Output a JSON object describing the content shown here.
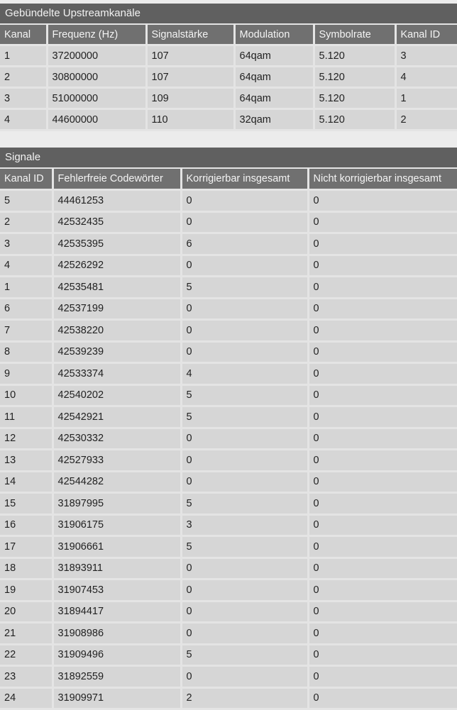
{
  "upstream": {
    "title": "Gebündelte Upstreamkanäle",
    "headers": [
      "Kanal",
      "Frequenz (Hz)",
      "Signalstärke",
      "Modulation",
      "Symbolrate",
      "Kanal ID"
    ],
    "rows": [
      [
        "1",
        "37200000",
        "107",
        "64qam",
        "5.120",
        "3"
      ],
      [
        "2",
        "30800000",
        "107",
        "64qam",
        "5.120",
        "4"
      ],
      [
        "3",
        "51000000",
        "109",
        "64qam",
        "5.120",
        "1"
      ],
      [
        "4",
        "44600000",
        "110",
        "32qam",
        "5.120",
        "2"
      ]
    ]
  },
  "signals": {
    "title": "Signale",
    "headers": [
      "Kanal ID",
      "Fehlerfreie Codewörter",
      "Korrigierbar insgesamt",
      "Nicht korrigierbar insgesamt"
    ],
    "rows": [
      [
        "5",
        "44461253",
        "0",
        "0"
      ],
      [
        "2",
        "42532435",
        "0",
        "0"
      ],
      [
        "3",
        "42535395",
        "6",
        "0"
      ],
      [
        "4",
        "42526292",
        "0",
        "0"
      ],
      [
        "1",
        "42535481",
        "5",
        "0"
      ],
      [
        "6",
        "42537199",
        "0",
        "0"
      ],
      [
        "7",
        "42538220",
        "0",
        "0"
      ],
      [
        "8",
        "42539239",
        "0",
        "0"
      ],
      [
        "9",
        "42533374",
        "4",
        "0"
      ],
      [
        "10",
        "42540202",
        "5",
        "0"
      ],
      [
        "11",
        "42542921",
        "5",
        "0"
      ],
      [
        "12",
        "42530332",
        "0",
        "0"
      ],
      [
        "13",
        "42527933",
        "0",
        "0"
      ],
      [
        "14",
        "42544282",
        "0",
        "0"
      ],
      [
        "15",
        "31897995",
        "5",
        "0"
      ],
      [
        "16",
        "31906175",
        "3",
        "0"
      ],
      [
        "17",
        "31906661",
        "5",
        "0"
      ],
      [
        "18",
        "31893911",
        "0",
        "0"
      ],
      [
        "19",
        "31907453",
        "0",
        "0"
      ],
      [
        "20",
        "31894417",
        "0",
        "0"
      ],
      [
        "21",
        "31908986",
        "0",
        "0"
      ],
      [
        "22",
        "31909496",
        "5",
        "0"
      ],
      [
        "23",
        "31892559",
        "0",
        "0"
      ],
      [
        "24",
        "31909971",
        "2",
        "0"
      ]
    ]
  }
}
